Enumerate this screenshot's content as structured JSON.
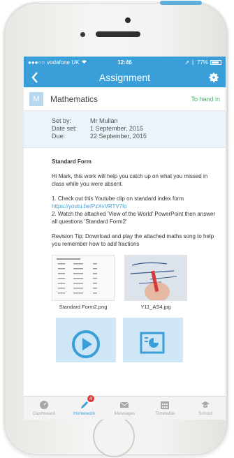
{
  "status": {
    "carrier": "vodafone UK",
    "time": "12:46",
    "battery": "77%"
  },
  "nav": {
    "title": "Assignment"
  },
  "subject": {
    "badge": "M",
    "name": "Mathematics",
    "status": "To hand in"
  },
  "details": {
    "set_by_label": "Set by:",
    "set_by": "Mr Mullan",
    "date_set_label": "Date set:",
    "date_set": "1 September, 2015",
    "due_label": "Due:",
    "due": "22 September, 2015"
  },
  "body": {
    "heading": "Standard Form",
    "intro": "Hi Mark, this work will help you catch up on what you missed in class while you were absent.",
    "step1": "1. Check out this Youtube clip on standard index form",
    "link": "https://youtu.be/PzXvVRTV7lo",
    "step2": "2. Watch the attached 'View of the World' PowerPoint then answer all questions 'Standard Form2'",
    "tip": "Revision Tip: Download and play the attached maths song to help you remember how to add fractions"
  },
  "attachments": [
    {
      "filename": "Standard Form2.png"
    },
    {
      "filename": "Y11_AS4.jpg"
    }
  ],
  "tabbar": {
    "items": [
      {
        "label": "Dashboard",
        "icon": "dashboard-icon"
      },
      {
        "label": "Homework",
        "icon": "pencil-icon",
        "badge": "4"
      },
      {
        "label": "Messages",
        "icon": "envelope-icon"
      },
      {
        "label": "Timetable",
        "icon": "calendar-icon"
      },
      {
        "label": "School",
        "icon": "graduation-cap-icon"
      }
    ],
    "active": "Homework"
  },
  "colors": {
    "accent": "#3a9fd8",
    "hand_in": "#4db36a",
    "badge": "#e23a3a"
  }
}
